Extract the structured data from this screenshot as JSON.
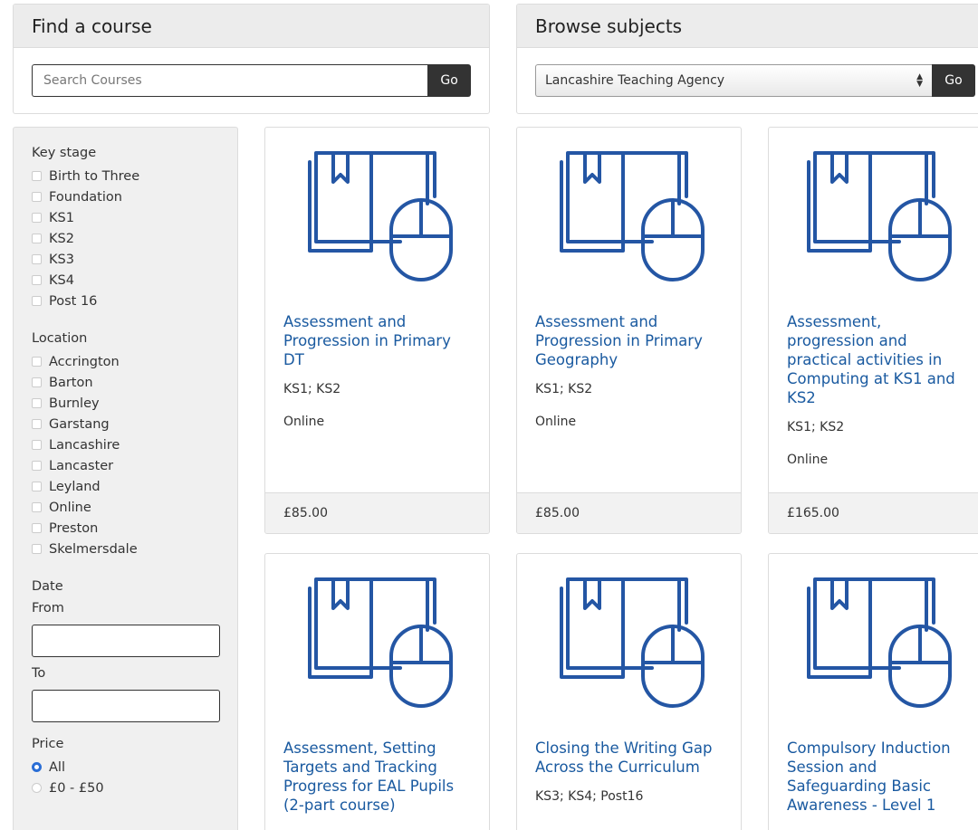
{
  "find": {
    "title": "Find a course",
    "search_placeholder": "Search Courses",
    "go_label": "Go"
  },
  "browse": {
    "title": "Browse subjects",
    "selected": "Lancashire Teaching Agency",
    "go_label": "Go"
  },
  "filters": {
    "key_stage": {
      "title": "Key stage",
      "options": [
        "Birth to Three",
        "Foundation",
        "KS1",
        "KS2",
        "KS3",
        "KS4",
        "Post 16"
      ]
    },
    "location": {
      "title": "Location",
      "options": [
        "Accrington",
        "Barton",
        "Burnley",
        "Garstang",
        "Lancashire",
        "Lancaster",
        "Leyland",
        "Online",
        "Preston",
        "Skelmersdale"
      ]
    },
    "date": {
      "title": "Date",
      "from_label": "From",
      "to_label": "To"
    },
    "price": {
      "title": "Price",
      "options": [
        "All",
        "£0 - £50"
      ],
      "selected": "All"
    }
  },
  "courses": [
    {
      "title": "Assessment and Progression in Primary DT",
      "stages": "KS1; KS2",
      "mode": "Online",
      "price": "£85.00"
    },
    {
      "title": "Assessment and Progression in Primary Geography",
      "stages": "KS1; KS2",
      "mode": "Online",
      "price": "£85.00"
    },
    {
      "title": "Assessment, progression and practical activities in Computing at KS1 and KS2",
      "stages": "KS1; KS2",
      "mode": "Online",
      "price": "£165.00"
    },
    {
      "title": "Assessment, Setting Targets and Tracking Progress for EAL Pupils (2-part course)",
      "stages": "",
      "mode": "",
      "price": ""
    },
    {
      "title": "Closing the Writing Gap Across the Curriculum",
      "stages": "KS3; KS4; Post16",
      "mode": "",
      "price": ""
    },
    {
      "title": "Compulsory Induction Session and Safeguarding Basic Awareness - Level 1",
      "stages": "",
      "mode": "",
      "price": ""
    }
  ],
  "icons": {
    "course_icon": "book-and-mouse-icon",
    "icon_color": "#2456a4"
  }
}
